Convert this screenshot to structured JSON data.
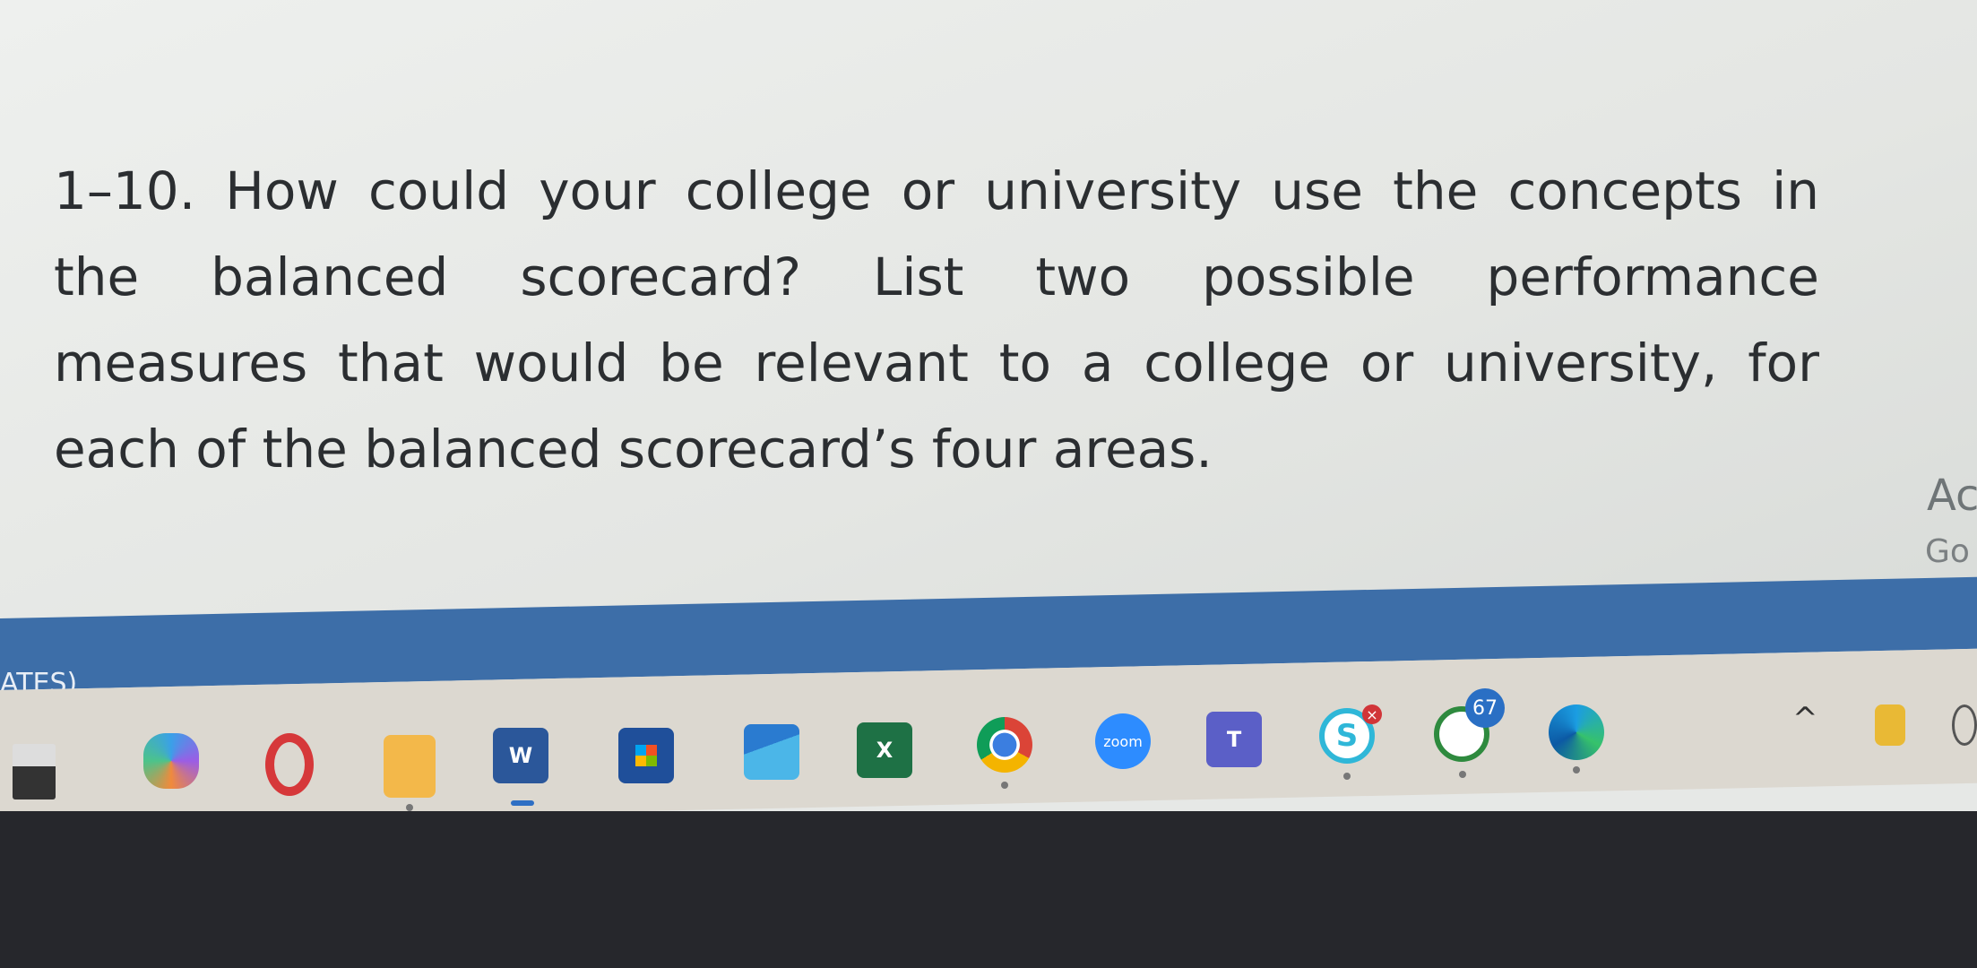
{
  "question": {
    "lines": [
      "1–10. How could your college or university use the concepts in",
      "the balanced scorecard? List two possible performance",
      "measures that would be relevant to a college or university, for",
      "each of the balanced scorecard’s four areas."
    ]
  },
  "watermark": {
    "line1": "Ac",
    "line2": "Go"
  },
  "status_bar": {
    "text": "ATES)"
  },
  "taskbar": {
    "apps": [
      {
        "name": "widgets-icon"
      },
      {
        "name": "copilot-icon"
      },
      {
        "name": "opera-icon"
      },
      {
        "name": "file-explorer-icon"
      },
      {
        "name": "word-icon",
        "label": "W"
      },
      {
        "name": "microsoft-store-icon"
      },
      {
        "name": "mail-icon"
      },
      {
        "name": "excel-icon",
        "label": "X"
      },
      {
        "name": "chrome-icon"
      },
      {
        "name": "zoom-icon",
        "label": "zoom"
      },
      {
        "name": "teams-icon",
        "label": "T"
      },
      {
        "name": "skype-icon",
        "label": "S"
      },
      {
        "name": "whatsapp-icon",
        "badge": "67"
      },
      {
        "name": "edge-icon"
      }
    ],
    "tray_caret": "^"
  }
}
